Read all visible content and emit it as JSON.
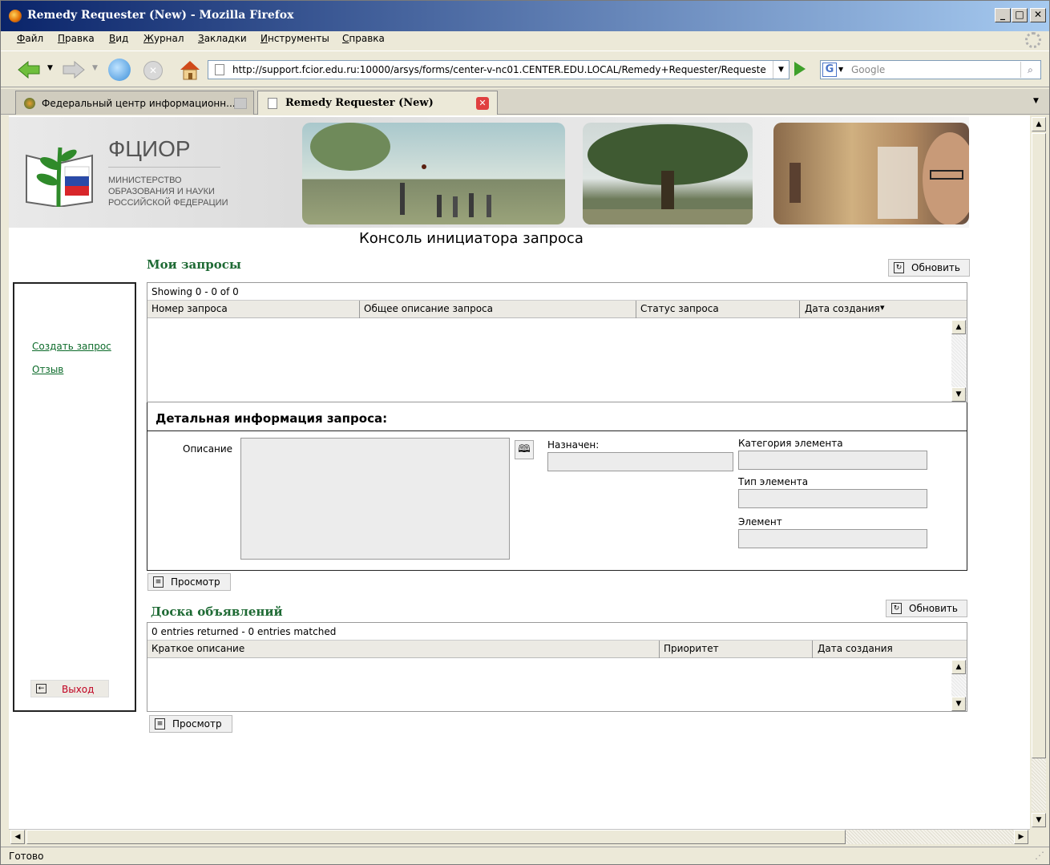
{
  "window": {
    "title": "Remedy Requester (New) - Mozilla Firefox"
  },
  "menu": [
    "Файл",
    "Правка",
    "Вид",
    "Журнал",
    "Закладки",
    "Инструменты",
    "Справка"
  ],
  "nav": {
    "url": "http://support.fcior.edu.ru:10000/arsys/forms/center-v-nc01.CENTER.EDU.LOCAL/Remedy+Requester/Requeste",
    "search_placeholder": "Google"
  },
  "tabs": [
    {
      "label": "Федеральный центр информационн..."
    },
    {
      "label": "Remedy Requester (New)"
    }
  ],
  "logo": {
    "title": "ФЦИОР",
    "line1": "МИНИСТЕРСТВО",
    "line2": "ОБРАЗОВАНИЯ И НАУКИ",
    "line3": "РОССИЙСКОЙ ФЕДЕРАЦИИ"
  },
  "page": {
    "heading": "Консоль инициатора запроса"
  },
  "sidebar": {
    "create": "Создать запрос",
    "feedback": "Отзыв",
    "logout": "Выход"
  },
  "my_requests": {
    "title": "Мои запросы",
    "refresh": "Обновить",
    "showing": "Showing 0 - 0 of 0",
    "columns": [
      "Номер запроса",
      "Общее описание запроса",
      "Статус запроса",
      "Дата создания"
    ],
    "sort_indicator": "▾"
  },
  "details": {
    "title": "Детальная информация запроса:",
    "description_label": "Описание",
    "assigned_label": "Назначен:",
    "category_label": "Категория элемента",
    "type_label": "Тип элемента",
    "item_label": "Элемент",
    "view_button": "Просмотр"
  },
  "board": {
    "title": "Доска объявлений",
    "refresh": "Обновить",
    "info": "0 entries returned - 0 entries matched",
    "columns": [
      "Краткое описание",
      "Приоритет",
      "Дата создания"
    ],
    "view_button": "Просмотр"
  },
  "status": {
    "text": "Готово"
  }
}
